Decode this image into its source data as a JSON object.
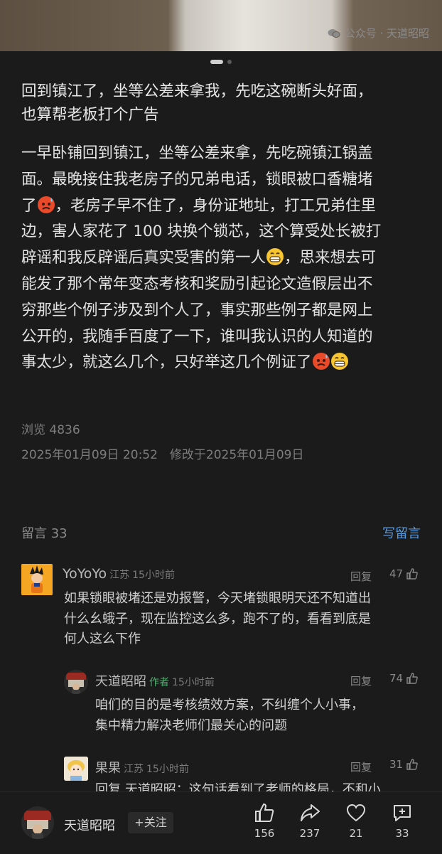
{
  "watermark": {
    "text": "公众号 · 天道昭昭",
    "icon": "wechat-icon"
  },
  "article": {
    "title_lines": [
      "回到镇江了，坐等公差来拿我，先吃这碗断头好面，",
      "也算帮老板打个广告"
    ],
    "body_lines": [
      "一早卧铺回到镇江，坐等公差来拿，先吃碗镇江锅盖",
      "面。最晚接住我老房子的兄弟电话，锁眼被口香糖堵",
      "了",
      "，老房子早不住了，身份证地址，打工兄弟住里",
      "边，害人家花了 100 块换个锁芯，这个算受处长被打",
      "辟谣和我反辟谣后真实受害的第一人",
      "，思来想去可",
      "能发了那个常年变态考核和奖励引起论文造假层出不",
      "穷那些个例子涉及到个人了，事实那些例子都是网上",
      "公开的，我随手百度了一下，谁叫我认识的人知道的",
      "事太少，就这么几个，只好举这几个例证了"
    ],
    "views": "浏览 4836",
    "date": "2025年01月09日 20:52　修改于2025年01月09日"
  },
  "comments_header": {
    "count": "留言 33",
    "write": "写留言"
  },
  "comments": [
    {
      "name": "YoYoYo",
      "loc": "江苏",
      "time": "15小时前",
      "reply": "回复",
      "likes": "47",
      "lines": [
        "如果锁眼被堵还是劝报警，今天堵锁眼明天还不知道出",
        "什么幺蛾子，现在监控这么多，跑不了的，看看到底是",
        "何人这么下作"
      ]
    },
    {
      "name": "天道昭昭",
      "tag": "作者",
      "time": "15小时前",
      "reply": "回复",
      "likes": "74",
      "lines": [
        "咱们的目的是考核绩效方案，不纠缠个人小事，",
        "集中精力解决老师们最关心的问题"
      ]
    },
    {
      "name": "果果",
      "loc": "江苏",
      "time": "15小时前",
      "reply": "回复",
      "likes": "31",
      "lines": [
        "回复 天道昭昭：这句话看到了老师的格局，不和小"
      ]
    }
  ],
  "bottom": {
    "name": "天道昭昭",
    "follow": "+关注",
    "like": "156",
    "share": "237",
    "favorite": "21",
    "comment": "33"
  }
}
